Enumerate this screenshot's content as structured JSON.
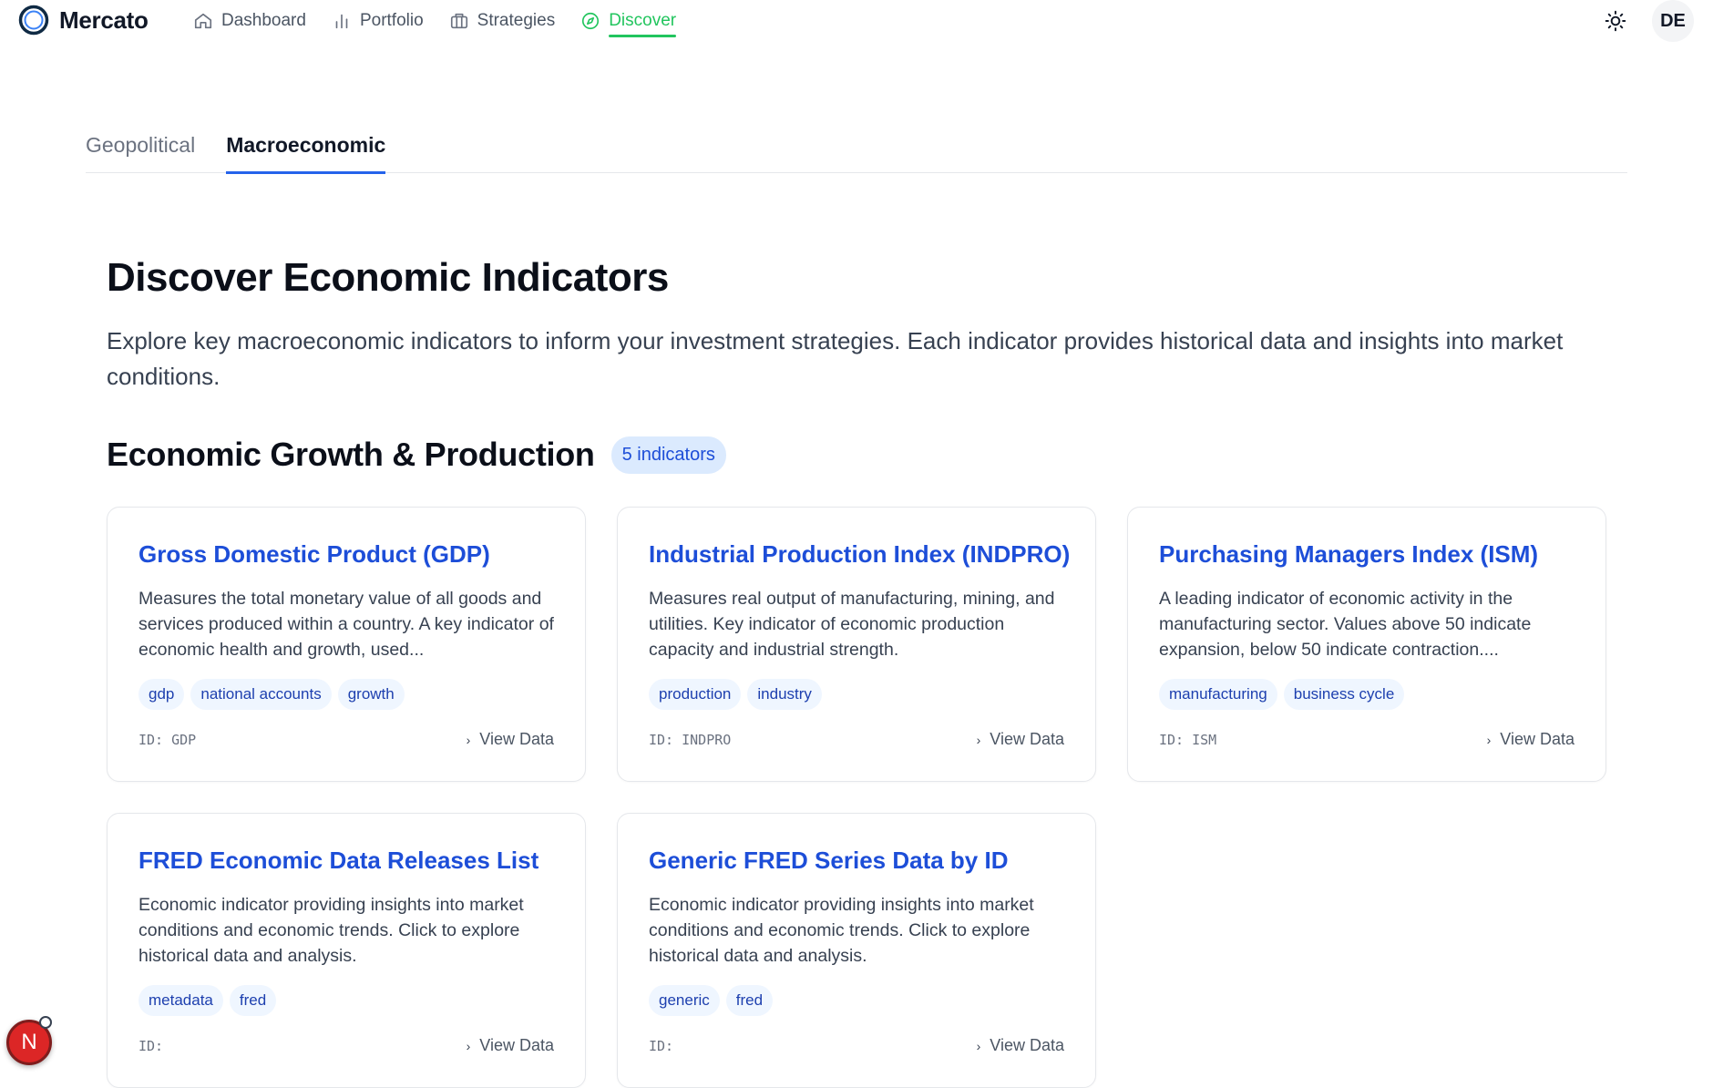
{
  "app": {
    "name": "Mercato"
  },
  "nav": {
    "items": [
      {
        "label": "Dashboard",
        "icon": "home-icon",
        "active": false
      },
      {
        "label": "Portfolio",
        "icon": "bar-chart-icon",
        "active": false
      },
      {
        "label": "Strategies",
        "icon": "briefcase-icon",
        "active": false
      },
      {
        "label": "Discover",
        "icon": "compass-icon",
        "active": true
      }
    ],
    "theme_icon": "sun-icon",
    "avatar": "DE"
  },
  "colors": {
    "accent_green": "#22c55e",
    "link_blue": "#1d4ed8",
    "tab_underline": "#2563eb"
  },
  "tabs": [
    {
      "label": "Geopolitical",
      "active": false
    },
    {
      "label": "Macroeconomic",
      "active": true
    }
  ],
  "page": {
    "title": "Discover Economic Indicators",
    "description": "Explore key macroeconomic indicators to inform your investment strategies. Each indicator provides historical data and insights into market conditions."
  },
  "section": {
    "title": "Economic Growth & Production",
    "badge": "5 indicators"
  },
  "cards": [
    {
      "title": "Gross Domestic Product (GDP)",
      "description": "Measures the total monetary value of all goods and services produced within a country. A key indicator of economic health and growth, used...",
      "tags": [
        "gdp",
        "national accounts",
        "growth"
      ],
      "id": "ID: GDP",
      "action": "View Data"
    },
    {
      "title": "Industrial Production Index (INDPRO)",
      "description": "Measures real output of manufacturing, mining, and utilities. Key indicator of economic production capacity and industrial strength.",
      "tags": [
        "production",
        "industry"
      ],
      "id": "ID: INDPRO",
      "action": "View Data"
    },
    {
      "title": "Purchasing Managers Index (ISM)",
      "description": "A leading indicator of economic activity in the manufacturing sector. Values above 50 indicate expansion, below 50 indicate contraction....",
      "tags": [
        "manufacturing",
        "business cycle"
      ],
      "id": "ID: ISM",
      "action": "View Data"
    },
    {
      "title": "FRED Economic Data Releases List",
      "description": "Economic indicator providing insights into market conditions and economic trends. Click to explore historical data and analysis.",
      "tags": [
        "metadata",
        "fred"
      ],
      "id": "ID:",
      "action": "View Data"
    },
    {
      "title": "Generic FRED Series Data by ID",
      "description": "Economic indicator providing insights into market conditions and economic trends. Click to explore historical data and analysis.",
      "tags": [
        "generic",
        "fred"
      ],
      "id": "ID:",
      "action": "View Data"
    }
  ],
  "floating_badge": {
    "label": "N"
  }
}
